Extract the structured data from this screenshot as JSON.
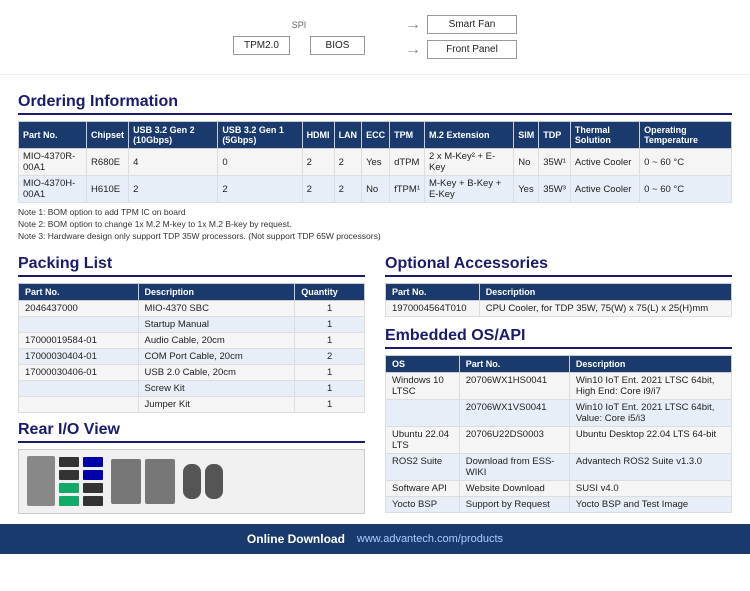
{
  "diagram": {
    "spi_label": "SPI",
    "boxes": [
      "TPM2.0",
      "BIOS"
    ],
    "right_boxes": [
      "Smart Fan",
      "Front Panel"
    ]
  },
  "ordering": {
    "section_title": "Ordering Information",
    "columns": [
      "Part No.",
      "Chipset",
      "USB 3.2 Gen 2 (10Gbps)",
      "USB 3.2 Gen 1 (5Gbps)",
      "HDMI",
      "LAN",
      "ECC",
      "TPM",
      "M.2 Extension",
      "SIM",
      "TDP",
      "Thermal Solution",
      "Operating Temperature"
    ],
    "rows": [
      {
        "part_no": "MIO-4370R-00A1",
        "chipset": "R680E",
        "usb32g2": "4",
        "usb32g1": "0",
        "hdmi": "2",
        "lan": "2",
        "ecc": "Yes",
        "tpm": "dTPM",
        "m2_ext": "2 x M-Key² + E-Key",
        "sim": "No",
        "tdp": "35W¹",
        "thermal": "Active Cooler",
        "operating_temp": "0 ~ 60 °C"
      },
      {
        "part_no": "MIO-4370H-00A1",
        "chipset": "H610E",
        "usb32g2": "2",
        "usb32g1": "2",
        "hdmi": "2",
        "lan": "2",
        "ecc": "No",
        "tpm": "fTPM¹",
        "m2_ext": "M-Key + B-Key + E-Key",
        "sim": "Yes",
        "tdp": "35W³",
        "thermal": "Active Cooler",
        "operating_temp": "0 ~ 60 °C"
      }
    ],
    "notes": [
      "Note 1: BOM option to add TPM IC on board",
      "Note 2: BOM option to change 1x M.2 M-key to 1x M.2 B-key by request.",
      "Note 3: Hardware design only support TDP 35W processors. (Not support TDP 65W processors)"
    ]
  },
  "packing_list": {
    "section_title": "Packing List",
    "columns": [
      "Part No.",
      "Description",
      "Quantity"
    ],
    "rows": [
      {
        "part_no": "2046437000",
        "description": "MIO-4370 SBC",
        "qty": "1"
      },
      {
        "part_no": "",
        "description": "Startup Manual",
        "qty": "1"
      },
      {
        "part_no": "17000019584-01",
        "description": "Audio Cable, 20cm",
        "qty": "1"
      },
      {
        "part_no": "17000030404-01",
        "description": "COM Port Cable, 20cm",
        "qty": "2"
      },
      {
        "part_no": "17000030406-01",
        "description": "USB 2.0 Cable, 20cm",
        "qty": "1"
      },
      {
        "part_no": "",
        "description": "Screw Kit",
        "qty": "1"
      },
      {
        "part_no": "",
        "description": "Jumper Kit",
        "qty": "1"
      }
    ]
  },
  "optional_accessories": {
    "section_title": "Optional Accessories",
    "columns": [
      "Part No.",
      "Description"
    ],
    "rows": [
      {
        "part_no": "1970004564T010",
        "description": "CPU Cooler, for TDP 35W, 75(W) x 75(L) x 25(H)mm"
      }
    ]
  },
  "embedded_os": {
    "section_title": "Embedded OS/API",
    "columns": [
      "OS",
      "Part No.",
      "Description"
    ],
    "rows": [
      {
        "os": "Windows 10 LTSC",
        "part_no": "20706WX1HS0041",
        "description": "Win10 IoT Ent. 2021 LTSC 64bit, High End: Core i9/i7"
      },
      {
        "os": "",
        "part_no": "20706WX1VS0041",
        "description": "Win10 IoT Ent. 2021 LTSC 64bit, Value: Core i5/i3"
      },
      {
        "os": "Ubuntu 22.04 LTS",
        "part_no": "20706U22DS0003",
        "description": "Ubuntu Desktop 22.04 LTS 64-bit"
      },
      {
        "os": "ROS2 Suite",
        "part_no": "Download from ESS-WIKI",
        "description": "Advantech ROS2 Suite v1.3.0"
      },
      {
        "os": "Software API",
        "part_no": "Website Download",
        "description": "SUSI v4.0"
      },
      {
        "os": "Yocto BSP",
        "part_no": "Support by Request",
        "description": "Yocto BSP and Test Image"
      }
    ]
  },
  "rear_io": {
    "section_title": "Rear I/O View"
  },
  "footer": {
    "label": "Online Download",
    "url": "www.advantech.com/products"
  }
}
